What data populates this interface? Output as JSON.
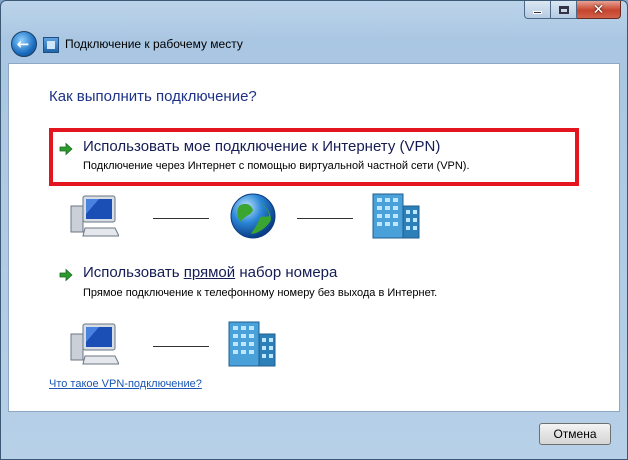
{
  "window": {
    "nav_title": "Подключение к рабочему месту",
    "caption": {
      "close_glyph": "✕"
    }
  },
  "main": {
    "question": "Как выполнить подключение?",
    "options": [
      {
        "title": "Использовать мое подключение к Интернету (VPN)",
        "description": "Подключение через Интернет с помощью виртуальной частной сети (VPN).",
        "highlighted": true,
        "diagram": [
          "computer-icon",
          "globe-icon",
          "office-building-icon"
        ]
      },
      {
        "title_prefix": "Использовать ",
        "title_underlined": "прямой",
        "title_suffix": " набор номера",
        "description": "Прямое подключение к телефонному номеру без выхода в Интернет.",
        "highlighted": false,
        "diagram": [
          "computer-icon",
          "office-building-icon"
        ]
      }
    ],
    "help_link": "Что такое VPN-подключение?"
  },
  "footer": {
    "cancel_label": "Отмена"
  },
  "colors": {
    "accent_text": "#1e3287",
    "highlight_border": "#e3151f",
    "link": "#1a56b3",
    "arrow_green": "#2c9a2c"
  }
}
